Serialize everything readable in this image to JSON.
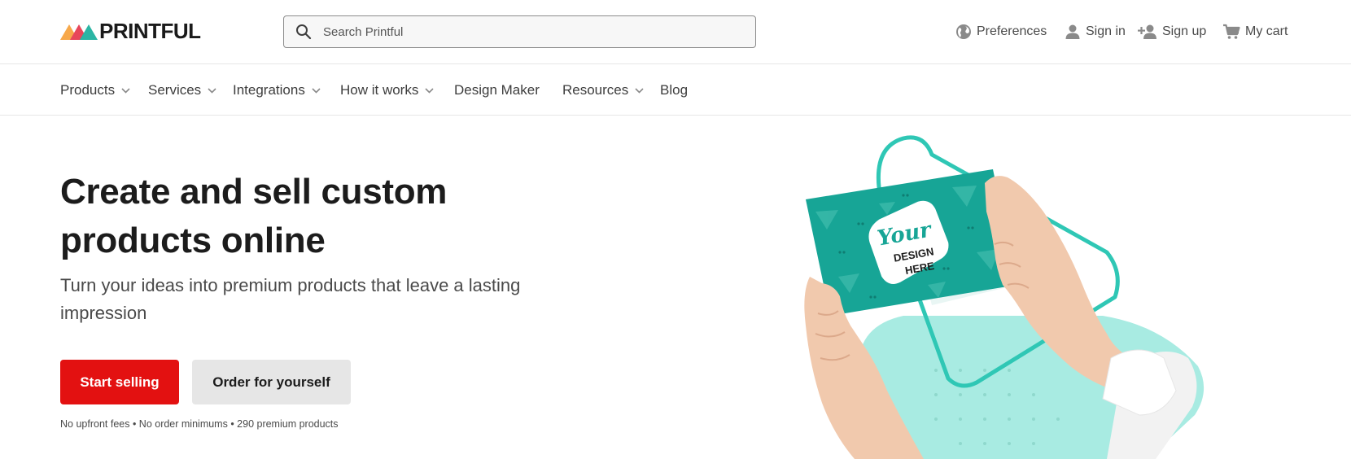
{
  "header": {
    "logo_text": "PRINTFUL",
    "search": {
      "placeholder": "Search Printful",
      "value": ""
    },
    "utilities": [
      {
        "label": "Preferences",
        "icon": "globe-icon"
      },
      {
        "label": "Sign in",
        "icon": "user-icon"
      },
      {
        "label": "Sign up",
        "icon": "user-plus-icon"
      },
      {
        "label": "My cart",
        "icon": "cart-icon"
      }
    ]
  },
  "nav": {
    "items": [
      {
        "label": "Products",
        "has_dropdown": true
      },
      {
        "label": "Services",
        "has_dropdown": true
      },
      {
        "label": "Integrations",
        "has_dropdown": true
      },
      {
        "label": "How it works",
        "has_dropdown": true
      },
      {
        "label": "Design Maker",
        "has_dropdown": false
      },
      {
        "label": "Resources",
        "has_dropdown": true
      },
      {
        "label": "Blog",
        "has_dropdown": false
      }
    ]
  },
  "hero": {
    "title_line1": "Create and sell custom",
    "title_line2": "products online",
    "subtitle": "Turn your ideas into premium products that leave a lasting impression",
    "primary_cta": "Start selling",
    "secondary_cta": "Order for yourself",
    "note": "No upfront fees • No order minimums • 290 premium products",
    "card": {
      "text_script": "Your",
      "text_line1": "DESIGN",
      "text_line2": "HERE"
    }
  },
  "colors": {
    "brand_red": "#e31111",
    "teal_card": "#17a596",
    "teal_light": "#a8ebe2",
    "text_dark": "#1c1c1c"
  }
}
